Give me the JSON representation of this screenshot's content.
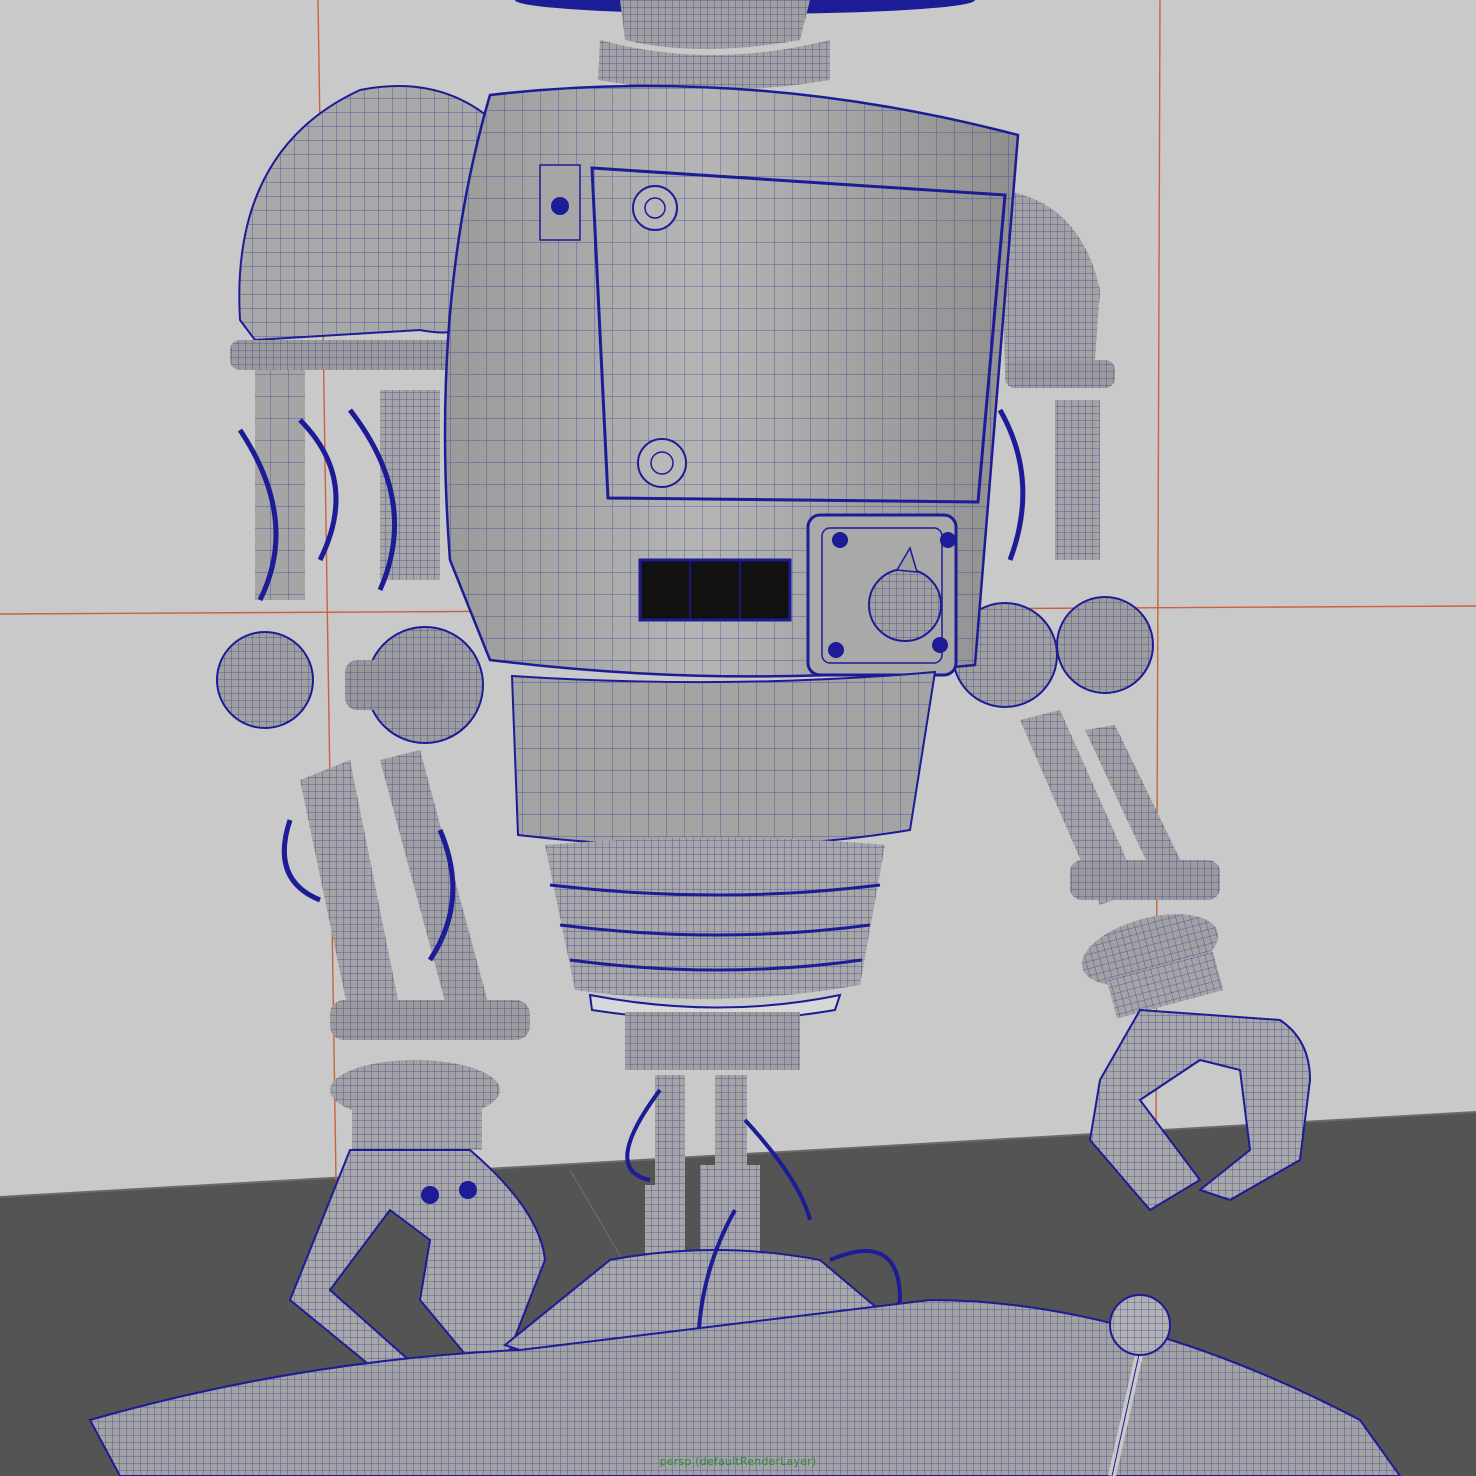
{
  "viewport": {
    "camera_label": "persp (defaultRenderLayer)",
    "colors": {
      "background": "#c9c9c9",
      "floor": "#545454",
      "wireframe": "#1c1c96",
      "model_fill": "#a6a6a6",
      "grid_axis": "#c8633c"
    }
  }
}
